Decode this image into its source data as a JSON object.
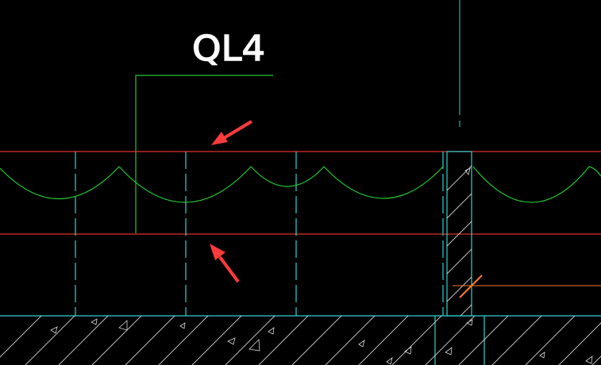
{
  "drawing": {
    "member_tag": "QL4",
    "colors": {
      "background": "#000000",
      "beam_lines": "#e0302a",
      "cloud": "#22c830",
      "leader": "#22c830",
      "grid": "#2fd1d1",
      "hatch": "#d8d8d8",
      "slab": "#2fd1d1",
      "arrow": "#ff3b3b",
      "dim": "#ff7a2a",
      "text": "#ffffff"
    }
  }
}
